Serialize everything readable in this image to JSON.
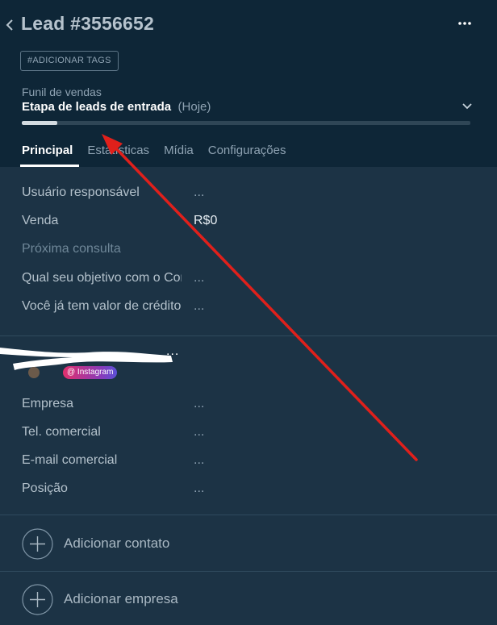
{
  "header": {
    "title": "Lead #3556652",
    "tags_button": "#ADICIONAR TAGS",
    "pipeline_label": "Funil de vendas",
    "stage_name": "Etapa de leads de entrada",
    "stage_date": "(Hoje)",
    "progress_fraction": 0.08,
    "tabs": [
      {
        "label": "Principal",
        "active": true
      },
      {
        "label": "Estatísticas",
        "active": false
      },
      {
        "label": "Mídia",
        "active": false
      },
      {
        "label": "Configurações",
        "active": false
      }
    ]
  },
  "fields": [
    {
      "label": "Usuário responsável",
      "value": "..."
    },
    {
      "label": "Venda",
      "value": "R$0"
    },
    {
      "label": "Próxima consulta",
      "value": ""
    },
    {
      "label": "Qual seu objetivo com o Consórcio?",
      "value": "..."
    },
    {
      "label": "Você já tem valor de crédito?",
      "value": "..."
    }
  ],
  "contact": {
    "more": "...",
    "badge": "@ Instagram"
  },
  "company_fields": [
    {
      "label": "Empresa",
      "value": "..."
    },
    {
      "label": "Tel. comercial",
      "value": "..."
    },
    {
      "label": "E-mail comercial",
      "value": "..."
    },
    {
      "label": "Posição",
      "value": "..."
    }
  ],
  "actions": {
    "add_contact": "Adicionar contato",
    "add_company": "Adicionar empresa"
  },
  "colors": {
    "header_bg": "#0e2637",
    "body_bg": "#1c3345",
    "annotation_arrow": "#e0201b",
    "instagram_gradient": [
      "#e1306c",
      "#8a3ab9",
      "#5b51d8"
    ]
  }
}
